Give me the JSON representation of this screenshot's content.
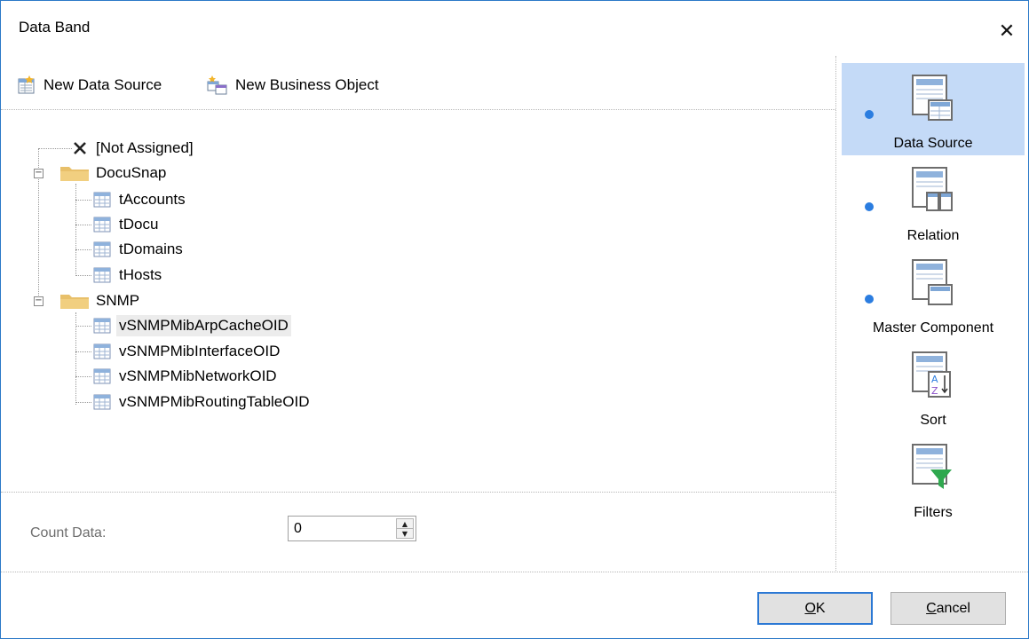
{
  "window": {
    "title": "Data Band",
    "close_glyph": "✕"
  },
  "toolbar": {
    "new_data_source": {
      "label": "New Data Source",
      "icon": "new-data-source-icon"
    },
    "new_business_object": {
      "label": "New Business Object",
      "icon": "new-business-object-icon"
    }
  },
  "tree": {
    "not_assigned": "[Not Assigned]",
    "groups": [
      {
        "label": "DocuSnap",
        "expanded": true,
        "items": [
          "tAccounts",
          "tDocu",
          "tDomains",
          "tHosts"
        ]
      },
      {
        "label": "SNMP",
        "expanded": true,
        "items": [
          "vSNMPMibArpCacheOID",
          "vSNMPMibInterfaceOID",
          "vSNMPMibNetworkOID",
          "vSNMPMibRoutingTableOID"
        ]
      }
    ],
    "selected": "vSNMPMibArpCacheOID"
  },
  "count_data": {
    "label": "Count Data:",
    "value": "0"
  },
  "sidebar": {
    "items": [
      {
        "label": "Data Source",
        "active": true
      },
      {
        "label": "Relation",
        "active": false
      },
      {
        "label": "Master Component",
        "active": false
      },
      {
        "label": "Sort",
        "active": false
      },
      {
        "label": "Filters",
        "active": false
      }
    ]
  },
  "buttons": {
    "ok": {
      "mnemonic": "O",
      "rest": "K"
    },
    "cancel": {
      "mnemonic": "C",
      "rest": "ancel"
    }
  },
  "colors": {
    "accent": "#2b7de0",
    "selection": "#c4daf7",
    "folder": "#e8c06a"
  }
}
